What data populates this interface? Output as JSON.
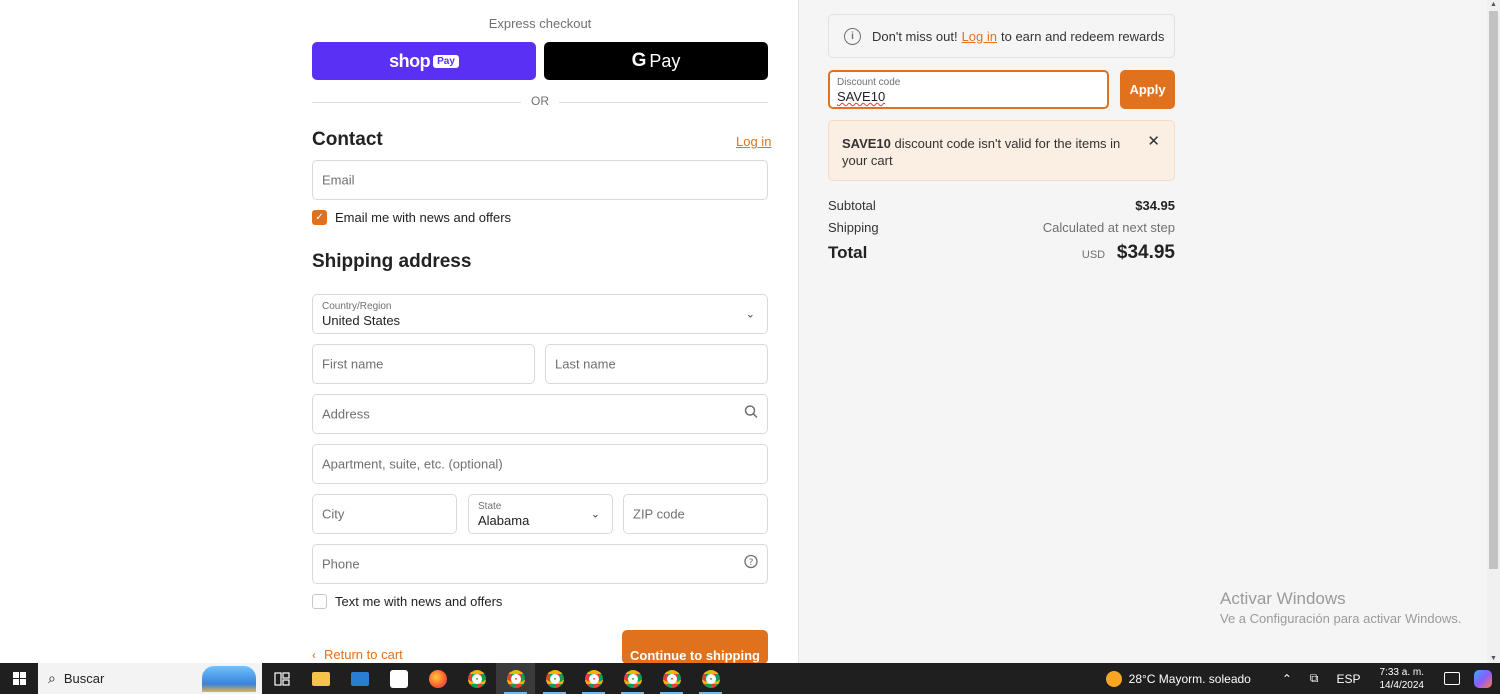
{
  "express": {
    "title": "Express checkout",
    "shop_pay_word": "shop",
    "shop_pay_tag": "Pay",
    "gpay_g": "G",
    "gpay_pay": "Pay",
    "or_label": "OR"
  },
  "contact": {
    "heading": "Contact",
    "login_link": "Log in",
    "email_placeholder": "Email",
    "email_value": "",
    "email_offers_label": "Email me with news and offers",
    "email_offers_checked": true
  },
  "shipping": {
    "heading": "Shipping address",
    "country_label": "Country/Region",
    "country_value": "United States",
    "first_name_placeholder": "First name",
    "last_name_placeholder": "Last name",
    "address_placeholder": "Address",
    "apartment_placeholder": "Apartment, suite, etc. (optional)",
    "city_placeholder": "City",
    "state_label": "State",
    "state_value": "Alabama",
    "zip_placeholder": "ZIP code",
    "phone_placeholder": "Phone",
    "text_offers_label": "Text me with news and offers",
    "text_offers_checked": false
  },
  "nav": {
    "return_label": "Return to cart",
    "continue_label": "Continue to shipping"
  },
  "summary": {
    "rewards_prefix": "Don't miss out!",
    "rewards_link": "Log in",
    "rewards_suffix": "to earn and redeem rewards",
    "discount_label": "Discount code",
    "discount_value": "SAVE10",
    "apply_label": "Apply",
    "error_code": "SAVE10",
    "error_message": "discount code isn't valid for the items in your cart",
    "subtotal_label": "Subtotal",
    "subtotal_value": "$34.95",
    "shipping_label": "Shipping",
    "shipping_value": "Calculated at next step",
    "total_label": "Total",
    "total_currency": "USD",
    "total_value": "$34.95"
  },
  "watermark": {
    "line1": "Activar Windows",
    "line2": "Ve a Configuración para activar Windows."
  },
  "taskbar": {
    "search_placeholder": "Buscar",
    "weather": "28°C  Mayorm. soleado",
    "language": "ESP",
    "time": "7:33 a. m.",
    "date": "14/4/2024"
  },
  "colors": {
    "accent": "#e0721e",
    "shop_pay": "#5a31f4",
    "error_bg": "#fbeee3"
  }
}
